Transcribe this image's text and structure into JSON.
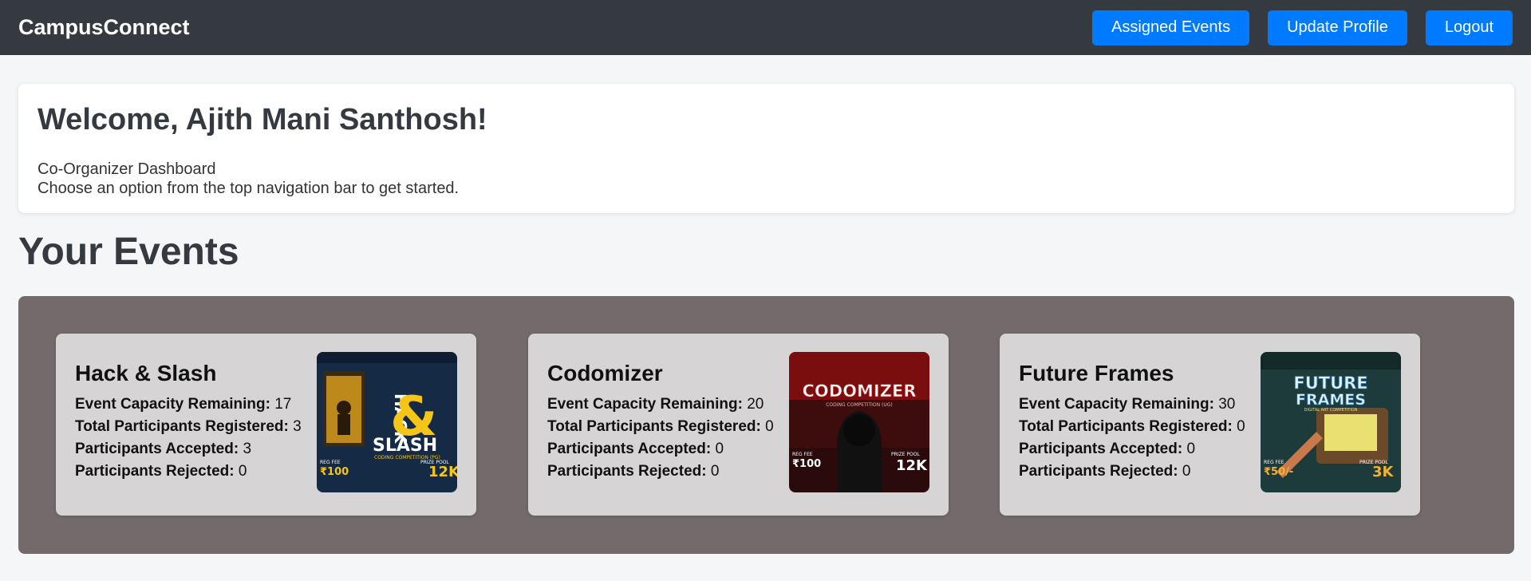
{
  "navbar": {
    "brand": "CampusConnect",
    "buttons": [
      "Assigned Events",
      "Update Profile",
      "Logout"
    ]
  },
  "welcome": {
    "title": "Welcome, Ajith Mani Santhosh!",
    "role": "Co-Organizer Dashboard",
    "hint": "Choose an option from the top navigation bar to get started."
  },
  "events_section": {
    "title": "Your Events",
    "stat_labels": {
      "capacity": "Event Capacity Remaining:",
      "registered": "Total Participants Registered:",
      "accepted": "Participants Accepted:",
      "rejected": "Participants Rejected:"
    },
    "events": [
      {
        "name": "Hack & Slash",
        "capacity": "17",
        "registered": "3",
        "accepted": "3",
        "rejected": "0",
        "poster": {
          "line1": "HACK",
          "line2": "SLASH",
          "tagline": "CODING COMPETITION (PG)",
          "fee_label": "REG FEE",
          "fee": "₹100",
          "prize_label": "PRIZE POOL",
          "prize": "12K"
        }
      },
      {
        "name": "Codomizer",
        "capacity": "20",
        "registered": "0",
        "accepted": "0",
        "rejected": "0",
        "poster": {
          "line1": "CODOMIZER",
          "tagline": "CODING COMPETITION (UG)",
          "fee_label": "REG FEE",
          "fee": "₹100",
          "prize_label": "PRIZE POOL",
          "prize": "12K"
        }
      },
      {
        "name": "Future Frames",
        "capacity": "30",
        "registered": "0",
        "accepted": "0",
        "rejected": "0",
        "poster": {
          "line1": "FUTURE",
          "line2": "FRAMES",
          "tagline": "DIGITAL ART COMPETITION",
          "fee_label": "REG FEE",
          "fee": "₹50/-",
          "prize_label": "PRIZE POOL",
          "prize": "3K"
        }
      }
    ]
  },
  "colors": {
    "navbar": "#343a40",
    "button": "#007bff",
    "panel": "#736b6b",
    "card": "#d6d4d4",
    "background": "#f5f6f8"
  }
}
